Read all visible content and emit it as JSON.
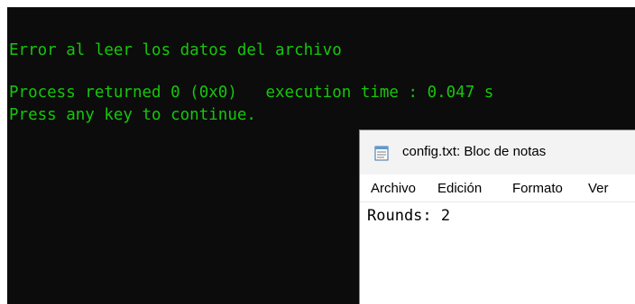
{
  "console": {
    "lines": [
      "Error al leer los datos del archivo",
      "Process returned 0 (0x0)   execution time : 0.047 s",
      "Press any key to continue."
    ],
    "text_color": "#16c60c",
    "background": "#0c0c0c"
  },
  "notepad": {
    "title": "config.txt: Bloc de notas",
    "icon": "notepad-icon",
    "menu": [
      "Archivo",
      "Edición",
      "Formato",
      "Ver"
    ],
    "content": "Rounds: 2"
  }
}
